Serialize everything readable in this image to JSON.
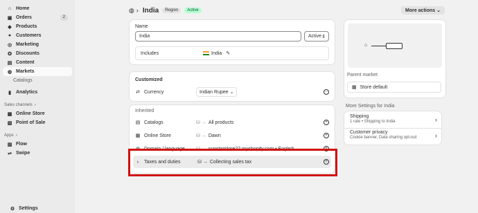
{
  "sidebar": {
    "items": [
      {
        "label": "Home",
        "icon": "home-icon"
      },
      {
        "label": "Orders",
        "icon": "orders-icon",
        "badge": "2"
      },
      {
        "label": "Products",
        "icon": "products-icon"
      },
      {
        "label": "Customers",
        "icon": "customers-icon"
      },
      {
        "label": "Marketing",
        "icon": "marketing-icon"
      },
      {
        "label": "Discounts",
        "icon": "discounts-icon"
      },
      {
        "label": "Content",
        "icon": "content-icon"
      },
      {
        "label": "Markets",
        "icon": "markets-icon"
      }
    ],
    "sub_item": "Catalogs",
    "analytics": "Analytics",
    "sales_channels_label": "Sales channels",
    "channels": [
      "Online Store",
      "Point of Sale"
    ],
    "apps_label": "Apps",
    "apps": [
      "Flow",
      "Swipe"
    ],
    "settings": "Settings"
  },
  "header": {
    "title": "India",
    "tag_region": "Region",
    "tag_active": "Active",
    "more_actions": "More actions"
  },
  "main": {
    "name_label": "Name",
    "name_value": "India",
    "status_value": "Active",
    "includes_label": "Includes",
    "includes_value": "India",
    "customized_label": "Customized",
    "currency_label": "Currency",
    "currency_value": "Indian Rupee",
    "inherited_label": "Inherited",
    "inherited_rows": [
      {
        "label": "Catalogs",
        "value": "All products"
      },
      {
        "label": "Online Store",
        "value": "Dawn"
      },
      {
        "label": "Domain / language",
        "value": "sunstorstore22.myshopify.com • English"
      },
      {
        "label": "Taxes and duties",
        "value": "Collecting sales tax"
      }
    ]
  },
  "right": {
    "parent_market_label": "Parent market",
    "store_default": "Store default",
    "more_settings_label": "More Settings for India",
    "shipping_title": "Shipping",
    "shipping_sub": "1 rate • Shipping to India",
    "privacy_title": "Customer privacy",
    "privacy_sub": "Cookie banner, Data sharing opt-out"
  },
  "colors": {
    "highlight": "#d10f0f",
    "active_tag_bg": "#b4fed2"
  }
}
